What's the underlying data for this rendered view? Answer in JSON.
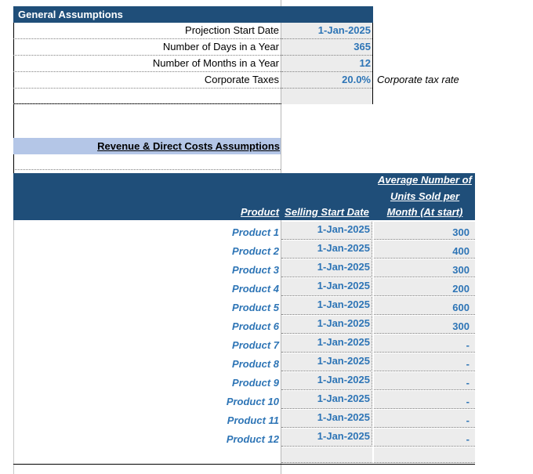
{
  "general": {
    "title": "General Assumptions",
    "rows": [
      {
        "label": "Projection Start Date",
        "value": "1-Jan-2025",
        "note": ""
      },
      {
        "label": "Number of Days in a Year",
        "value": "365",
        "note": ""
      },
      {
        "label": "Number of Months in a Year",
        "value": "12",
        "note": ""
      },
      {
        "label": "Corporate Taxes",
        "value": "20.0%",
        "note": "Corporate tax rate"
      }
    ]
  },
  "revenue": {
    "title": "Revenue & Direct Costs Assumptions",
    "col_product": "Product",
    "col_start": "Selling Start Date",
    "col_units_line1": "Average Number of",
    "col_units_line2": "Units Sold per",
    "col_units_line3": "Month (At start)",
    "products": [
      {
        "name": "Product 1",
        "start": "1-Jan-2025",
        "units": "300"
      },
      {
        "name": "Product 2",
        "start": "1-Jan-2025",
        "units": "400"
      },
      {
        "name": "Product 3",
        "start": "1-Jan-2025",
        "units": "300"
      },
      {
        "name": "Product 4",
        "start": "1-Jan-2025",
        "units": "200"
      },
      {
        "name": "Product 5",
        "start": "1-Jan-2025",
        "units": "600"
      },
      {
        "name": "Product 6",
        "start": "1-Jan-2025",
        "units": "300"
      },
      {
        "name": "Product 7",
        "start": "1-Jan-2025",
        "units": "-"
      },
      {
        "name": "Product 8",
        "start": "1-Jan-2025",
        "units": "-"
      },
      {
        "name": "Product 9",
        "start": "1-Jan-2025",
        "units": "-"
      },
      {
        "name": "Product 10",
        "start": "1-Jan-2025",
        "units": "-"
      },
      {
        "name": "Product 11",
        "start": "1-Jan-2025",
        "units": "-"
      },
      {
        "name": "Product 12",
        "start": "1-Jan-2025",
        "units": "-"
      }
    ]
  },
  "colors": {
    "header_dark": "#1f4e79",
    "header_light": "#b4c6e7",
    "value_blue": "#2e75b6",
    "input_bg": "#ececec"
  }
}
